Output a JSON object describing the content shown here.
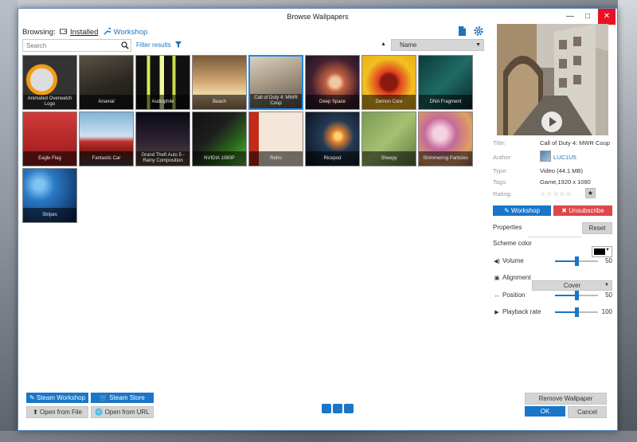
{
  "window": {
    "title": "Browse Wallpapers",
    "controls": {
      "minimize": "—",
      "maximize": "□",
      "close": "✕"
    }
  },
  "browse": {
    "label": "Browsing:",
    "installed": "Installed",
    "workshop": "Workshop"
  },
  "search": {
    "placeholder": "Search"
  },
  "filter": {
    "label": "Filter results"
  },
  "sort": {
    "direction": "▲",
    "value": "Name"
  },
  "wallpapers": [
    {
      "name": "Animated Overwatch Logo",
      "art": "overwatch"
    },
    {
      "name": "Arsenal",
      "art": "arsenal"
    },
    {
      "name": "Audiophile",
      "art": "audio"
    },
    {
      "name": "Beach",
      "art": "beach"
    },
    {
      "name": "Call of Duty 4: MWR Coup",
      "art": "cod",
      "selected": true
    },
    {
      "name": "Deep Space",
      "art": "space"
    },
    {
      "name": "Demon Core",
      "art": "demon"
    },
    {
      "name": "DNA Fragment",
      "art": "dna"
    },
    {
      "name": "Eagle Flag",
      "art": "eagle"
    },
    {
      "name": "Fantastic Car",
      "art": "car"
    },
    {
      "name": "Grand Theft Auto 5 - Rainy Composition",
      "art": "gta"
    },
    {
      "name": "NVIDIA 1080P",
      "art": "nvidia"
    },
    {
      "name": "Retro",
      "art": "retro"
    },
    {
      "name": "Ricepod",
      "art": "ricepod"
    },
    {
      "name": "Sheepy",
      "art": "sheepy"
    },
    {
      "name": "Shimmering Particles",
      "art": "particles"
    },
    {
      "name": "Stripes",
      "art": "stripes"
    }
  ],
  "details": {
    "title_label": "Title:",
    "title_value": "Call of Duty 4: MWR Coup",
    "author_label": "Author:",
    "author_value": "LUC1U5",
    "type_label": "Type:",
    "type_value": "Video (44.1 MB)",
    "tags_label": "Tags:",
    "tags_value": "Game,1920 x 1080",
    "rating_label": "Rating:",
    "rating_stars": "☆☆☆☆☆",
    "rating_button": "★"
  },
  "actions": {
    "workshop": "Workshop",
    "unsubscribe": "Unsubscribe"
  },
  "properties": {
    "label": "Properties",
    "reset": "Reset",
    "scheme_color_label": "Scheme color",
    "scheme_color": "#000000",
    "volume_label": "Volume",
    "volume_value": "50",
    "volume_level": 50,
    "alignment_label": "Alignment",
    "alignment_value": "Cover",
    "position_label": "Position",
    "position_value": "50",
    "position_level": 50,
    "playback_label": "Playback rate",
    "playback_value": "100",
    "playback_level": 50
  },
  "bottom": {
    "steam_workshop": "Steam Workshop",
    "steam_store": "Steam Store",
    "open_file": "Open from File",
    "open_url": "Open from URL",
    "remove": "Remove Wallpaper",
    "ok": "OK",
    "cancel": "Cancel"
  },
  "colors": {
    "accent": "#1976c8",
    "danger": "#e0464a",
    "close": "#e81123"
  }
}
